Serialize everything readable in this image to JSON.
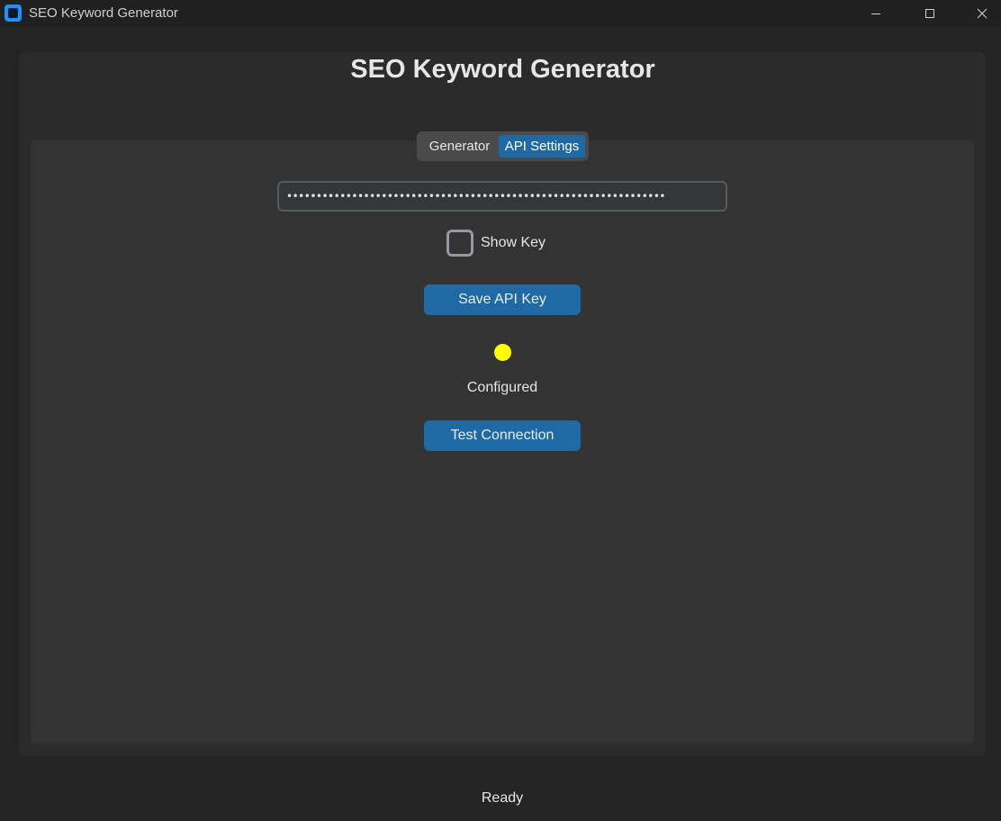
{
  "window": {
    "title": "SEO Keyword Generator",
    "controls": {
      "minimize": "minimize",
      "maximize": "maximize",
      "close": "close"
    }
  },
  "header": {
    "title": "SEO Keyword Generator"
  },
  "tabs": [
    {
      "label": "Generator",
      "selected": false
    },
    {
      "label": "API Settings",
      "selected": true
    }
  ],
  "api_settings": {
    "api_key_masked": "••••••••••••••••••••••••••••••••••••••••••••••••••••••••••••••••",
    "show_key_label": "Show Key",
    "show_key_checked": false,
    "save_button_label": "Save API Key",
    "status_text": "Configured",
    "status_color": "#ffff00",
    "test_button_label": "Test Connection"
  },
  "statusbar": {
    "text": "Ready"
  },
  "colors": {
    "accent": "#1f6aa5",
    "background": "#242424",
    "frame": "#2b2b2b",
    "panel": "#333333",
    "app_icon": "#1e90ff"
  },
  "icons": {
    "app": "app-icon",
    "minimize": "minimize-icon",
    "maximize": "maximize-icon",
    "close": "close-icon"
  }
}
